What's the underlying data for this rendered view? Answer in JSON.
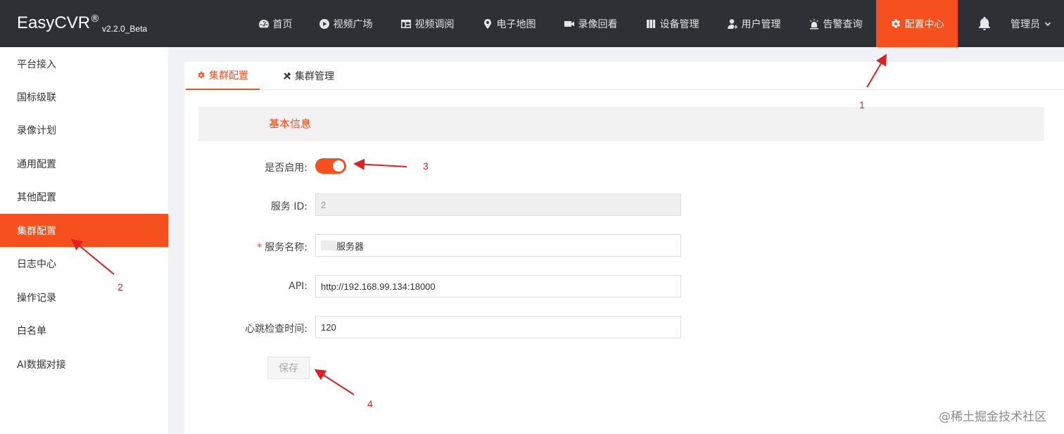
{
  "brand": {
    "name": "EasyCVR",
    "reg": "®",
    "version": "v2.2.0_Beta"
  },
  "nav": [
    {
      "id": "home",
      "label": "首页",
      "icon": "dashboard-icon"
    },
    {
      "id": "video-square",
      "label": "视频广场",
      "icon": "play-circle-icon"
    },
    {
      "id": "video-browse",
      "label": "视频调阅",
      "icon": "layout-icon"
    },
    {
      "id": "map",
      "label": "电子地图",
      "icon": "map-pin-icon"
    },
    {
      "id": "playback",
      "label": "录像回看",
      "icon": "video-camera-icon"
    },
    {
      "id": "devices",
      "label": "设备管理",
      "icon": "columns-icon"
    },
    {
      "id": "users",
      "label": "用户管理",
      "icon": "user-icon"
    },
    {
      "id": "alarms",
      "label": "告警查询",
      "icon": "alarm-light-icon"
    },
    {
      "id": "config",
      "label": "配置中心",
      "icon": "gear-icon",
      "active": true
    }
  ],
  "user": {
    "label": "管理员"
  },
  "sidebar": {
    "items": [
      {
        "label": "平台接入"
      },
      {
        "label": "国标级联"
      },
      {
        "label": "录像计划"
      },
      {
        "label": "通用配置"
      },
      {
        "label": "其他配置"
      },
      {
        "label": "集群配置",
        "active": true
      },
      {
        "label": "日志中心"
      },
      {
        "label": "操作记录"
      },
      {
        "label": "白名单"
      },
      {
        "label": "AI数据对接"
      }
    ]
  },
  "tabs": [
    {
      "label": "集群配置",
      "icon": "gear-icon",
      "active": true
    },
    {
      "label": "集群管理",
      "icon": "tools-icon"
    }
  ],
  "section": {
    "title": "基本信息"
  },
  "form": {
    "enable_label": "是否启用:",
    "enable_on": true,
    "service_id_label": "服务 ID:",
    "service_id_value": "2",
    "service_name_label": "服务名称:",
    "service_name_required": "*",
    "service_name_value": "服务器",
    "api_label": "API:",
    "api_value": "http://192.168.99.134:18000",
    "heartbeat_label": "心跳检查时间:",
    "heartbeat_value": "120",
    "save_label": "保存"
  },
  "annotations": {
    "n1": "1",
    "n2": "2",
    "n3": "3",
    "n4": "4"
  },
  "watermark": "@稀土掘金技术社区",
  "colors": {
    "accent": "#f5501e",
    "topbar": "#2d3035",
    "arrow": "#e02020"
  }
}
